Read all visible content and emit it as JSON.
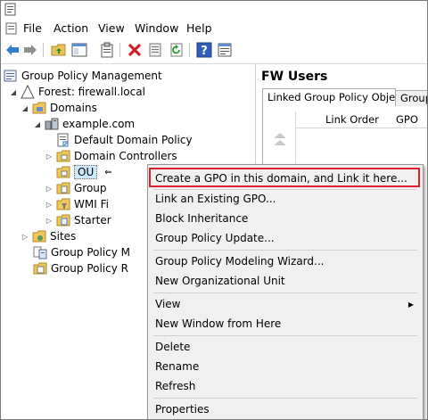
{
  "menu": {
    "file": "File",
    "action": "Action",
    "view": "View",
    "window": "Window",
    "help": "Help"
  },
  "toolbar": {
    "icons": [
      "back-arrow-icon",
      "forward-arrow-icon",
      "folder-up-icon",
      "show-hide-tree-icon",
      "clipboard-icon",
      "delete-icon",
      "properties-icon",
      "refresh-icon",
      "help-icon",
      "snapin-icon"
    ]
  },
  "tree": {
    "root": "Group Policy Management",
    "forest": "Forest: firewall.local",
    "domains": "Domains",
    "domain": "example.com",
    "default_policy": "Default Domain Policy",
    "domain_controllers": "Domain Controllers",
    "ou": "OU",
    "group_policy_objects": "Group",
    "wmi_filters": "WMI Fi",
    "starter_gpos": "Starter",
    "sites": "Sites",
    "modeling": "Group Policy M",
    "results": "Group Policy R"
  },
  "details": {
    "title": "FW Users",
    "tabs": [
      "Linked Group Policy Objects",
      "Group"
    ],
    "columns": [
      "Link Order",
      "GPO"
    ]
  },
  "context_menu": {
    "create_link": "Create a GPO in this domain, and Link it here...",
    "link_existing": "Link an Existing GPO...",
    "block_inheritance": "Block Inheritance",
    "gp_update": "Group Policy Update...",
    "modeling_wizard": "Group Policy Modeling Wizard...",
    "new_ou": "New Organizational Unit",
    "view": "View",
    "new_window": "New Window from Here",
    "delete": "Delete",
    "rename": "Rename",
    "refresh": "Refresh",
    "properties": "Properties"
  },
  "colors": {
    "highlight_border": "#e0202e",
    "selection_bg": "#cce8ff"
  }
}
